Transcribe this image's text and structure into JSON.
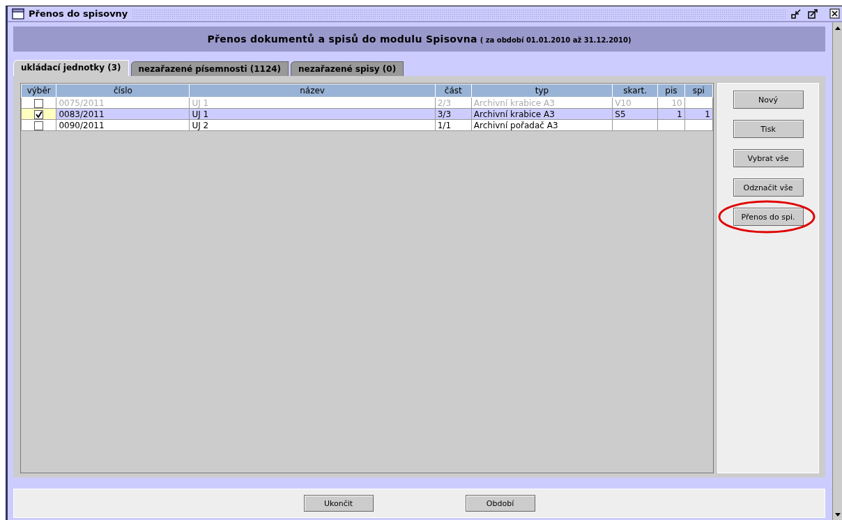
{
  "window": {
    "title": "Přenos do spisovny"
  },
  "header": {
    "title": "Přenos dokumentů a spisů do modulu Spisovna",
    "period": "( za období 01.01.2010 až 31.12.2010)"
  },
  "tabs": [
    {
      "label": "ukládací jednotky (3)",
      "selected": true
    },
    {
      "label": "nezařazené písemnosti (1124)",
      "selected": false
    },
    {
      "label": "nezařazené spisy (0)",
      "selected": false
    }
  ],
  "table": {
    "columns": [
      "výběr",
      "číslo",
      "název",
      "část",
      "typ",
      "skart.",
      "pis",
      "spi"
    ],
    "rows": [
      {
        "checked": false,
        "selected": false,
        "disabled": true,
        "cells": [
          "",
          "0075/2011",
          "UJ 1",
          "2/3",
          "Archivní krabice A3",
          "V10",
          "10",
          ""
        ]
      },
      {
        "checked": true,
        "selected": true,
        "disabled": false,
        "cells": [
          "",
          "0083/2011",
          "UJ 1",
          "3/3",
          "Archivní krabice A3",
          "S5",
          "1",
          "1"
        ]
      },
      {
        "checked": false,
        "selected": false,
        "disabled": false,
        "cells": [
          "",
          "0090/2011",
          "UJ 2",
          "1/1",
          "Archivní pořadač A3",
          "",
          "",
          ""
        ]
      }
    ]
  },
  "side_buttons": [
    {
      "label": "Nový",
      "highlighted": false
    },
    {
      "label": "Tisk",
      "highlighted": false
    },
    {
      "label": "Vybrat vše",
      "highlighted": false
    },
    {
      "label": "Odznačit vše",
      "highlighted": false
    },
    {
      "label": "Přenos do spi.",
      "highlighted": true
    }
  ],
  "footer_buttons": [
    "Ukončit",
    "Období"
  ]
}
